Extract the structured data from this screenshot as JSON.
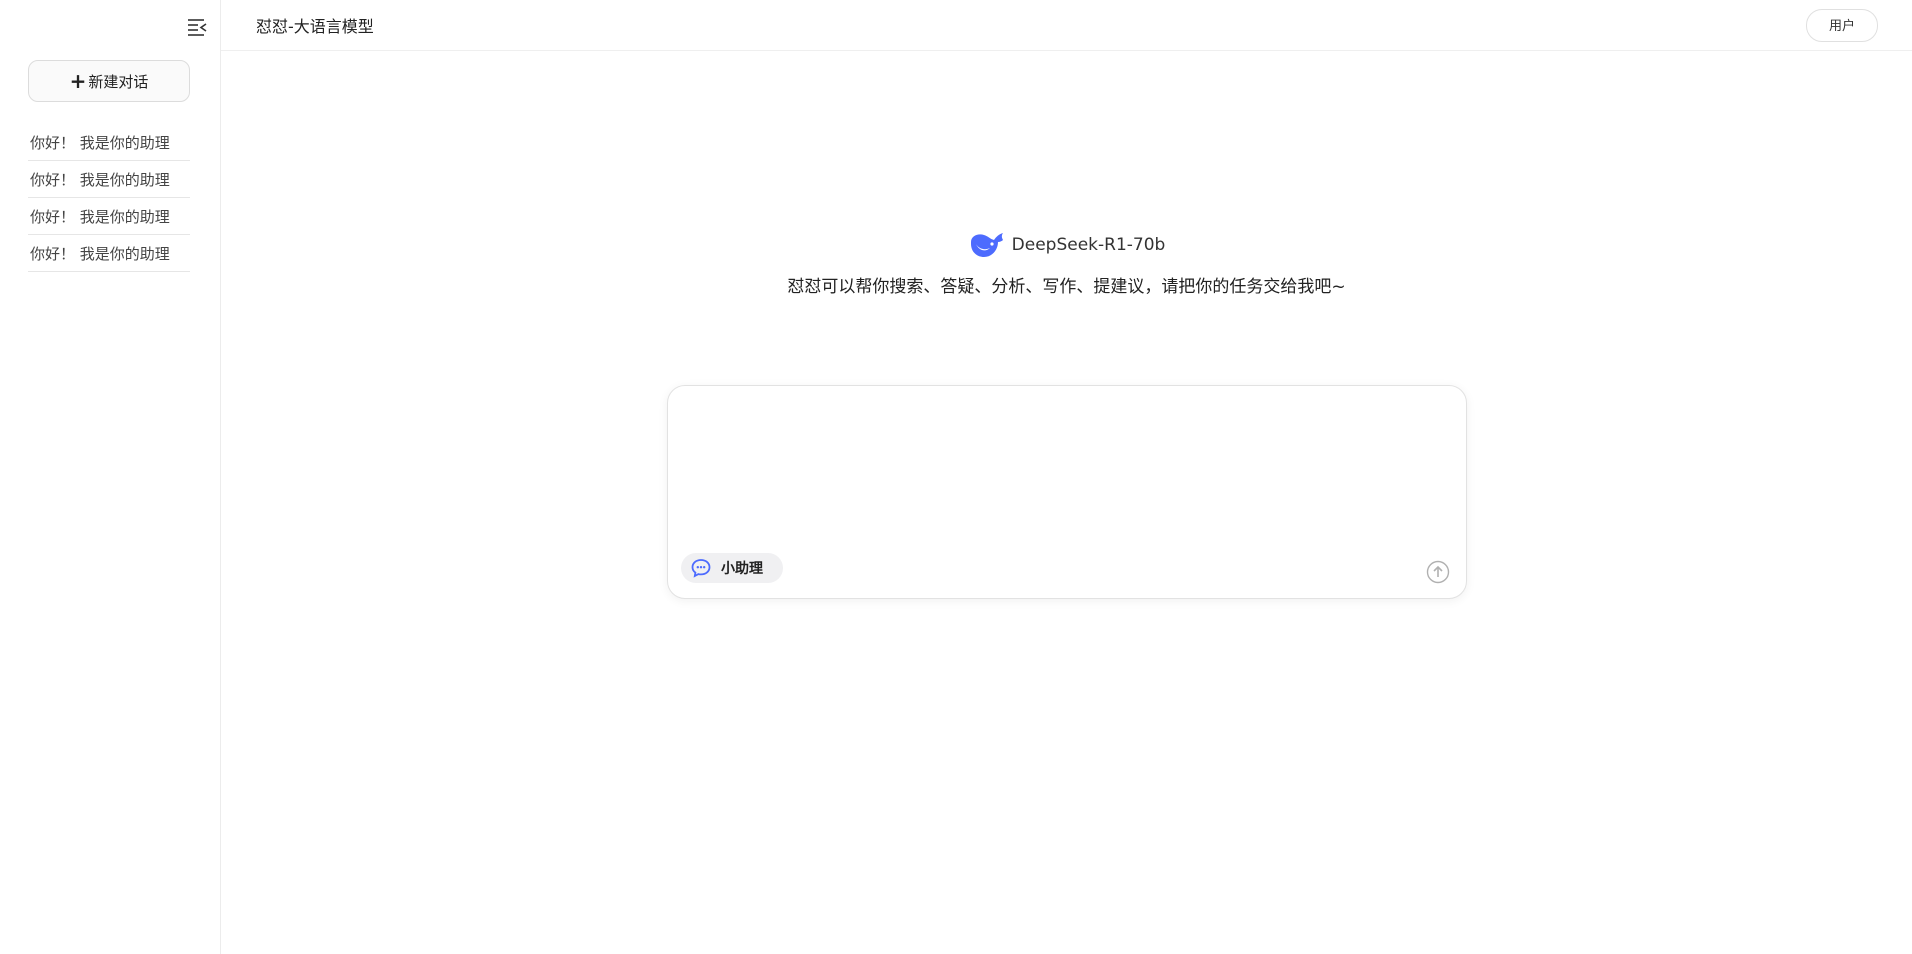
{
  "sidebar": {
    "collapse_icon": "sidebar-collapse-icon",
    "new_chat_label": "新建对话",
    "history": [
      {
        "label": "你好！ 我是你的助理"
      },
      {
        "label": "你好！ 我是你的助理"
      },
      {
        "label": "你好！ 我是你的助理"
      },
      {
        "label": "你好！ 我是你的助理"
      }
    ]
  },
  "header": {
    "title": "怼怼-大语言模型",
    "user_label": "用户"
  },
  "hero": {
    "model_name": "DeepSeek-R1-70b",
    "tagline": "怼怼可以帮你搜索、答疑、分析、写作、提建议，请把你的任务交给我吧~"
  },
  "composer": {
    "placeholder": "",
    "assistant_label": "小助理",
    "send_icon": "send-arrow-up-icon"
  },
  "colors": {
    "brand": "#4D6BFE",
    "border": "#e2e2e2",
    "chip_bg": "#f0f0f2"
  }
}
